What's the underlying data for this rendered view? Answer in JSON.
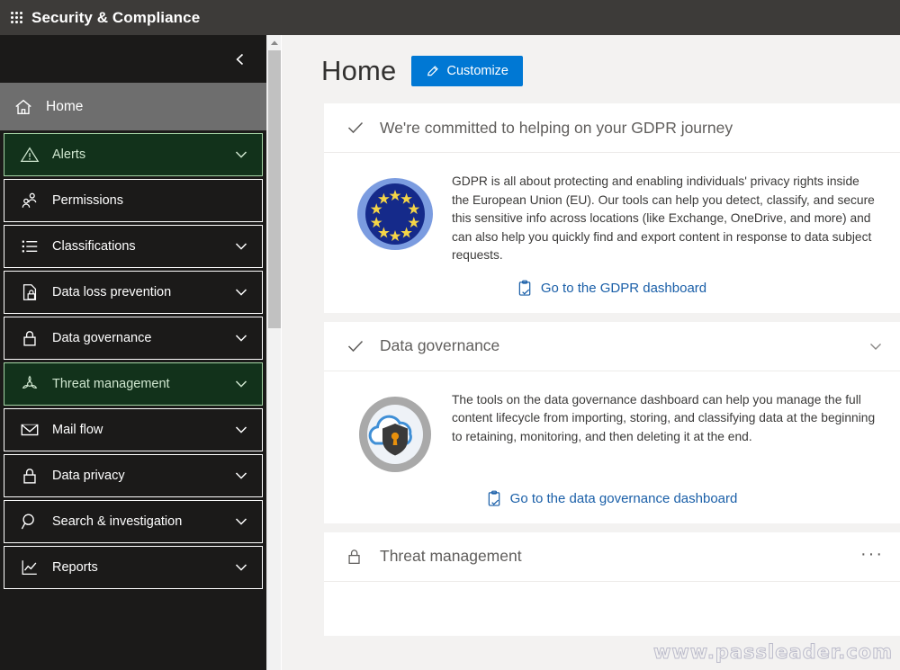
{
  "suite": {
    "waffle_icon": "waffle-grid-icon",
    "title": "Security & Compliance"
  },
  "sidebar": {
    "collapse_icon": "chevron-left-icon",
    "items": [
      {
        "label": "Home",
        "icon": "home-icon",
        "state": "selected",
        "chevron": false
      },
      {
        "label": "Alerts",
        "icon": "warning-icon",
        "state": "highlighted",
        "chevron": true
      },
      {
        "label": "Permissions",
        "icon": "people-icon",
        "state": "normal",
        "chevron": false
      },
      {
        "label": "Classifications",
        "icon": "list-icon",
        "state": "normal",
        "chevron": true
      },
      {
        "label": "Data loss prevention",
        "icon": "document-lock-icon",
        "state": "normal",
        "chevron": true
      },
      {
        "label": "Data governance",
        "icon": "lock-icon",
        "state": "normal",
        "chevron": true
      },
      {
        "label": "Threat management",
        "icon": "biohazard-icon",
        "state": "highlighted",
        "chevron": true
      },
      {
        "label": "Mail flow",
        "icon": "mail-icon",
        "state": "normal",
        "chevron": true
      },
      {
        "label": "Data privacy",
        "icon": "lock-icon",
        "state": "normal",
        "chevron": true
      },
      {
        "label": "Search & investigation",
        "icon": "search-icon",
        "state": "normal",
        "chevron": true
      },
      {
        "label": "Reports",
        "icon": "chart-line-icon",
        "state": "normal",
        "chevron": true
      }
    ],
    "scrollbar": {
      "up_arrow_icon": "scroll-up-arrow-icon"
    }
  },
  "main": {
    "page_title": "Home",
    "customize_label": "Customize",
    "customize_icon": "pencil-icon",
    "cards": [
      {
        "title": "We're committed to helping on your GDPR journey",
        "head_icon": "check-icon",
        "illustration": "eu-flag-icon",
        "body": "GDPR is all about protecting and enabling individuals' privacy rights inside the European Union (EU). Our tools can help you detect, classify, and secure this sensitive info across locations (like Exchange, OneDrive, and more) and can also help you quickly find and export content in response to data subject requests.",
        "link_label": "Go to the GDPR dashboard",
        "link_icon": "clipboard-check-icon"
      },
      {
        "title": "Data governance",
        "head_icon": "check-icon",
        "head_chevron": "chevron-down-icon",
        "illustration": "cloud-shield-lock-icon",
        "body": "The tools on the data governance dashboard can help you manage the full content lifecycle from importing, storing, and classifying data at the beginning to retaining, monitoring, and then deleting it at the end.",
        "link_label": "Go to the data governance dashboard",
        "link_icon": "clipboard-check-icon"
      },
      {
        "title": "Threat management",
        "head_icon": "lock-icon",
        "overflow_icon": "ellipsis-icon",
        "overflow_label": "···"
      }
    ]
  },
  "watermark": {
    "text": "www.passleader.com"
  },
  "colors": {
    "suitebar_bg": "#3d3b39",
    "nav_bg": "#1b1a19",
    "nav_selected_bg": "#6e6e6e",
    "nav_highlight_bg": "#12321b",
    "nav_highlight_border": "#a6d6a6",
    "accent_blue": "#0078d4",
    "link_blue": "#1a5fa8",
    "content_bg": "#f3f2f1",
    "card_bg": "#ffffff"
  }
}
